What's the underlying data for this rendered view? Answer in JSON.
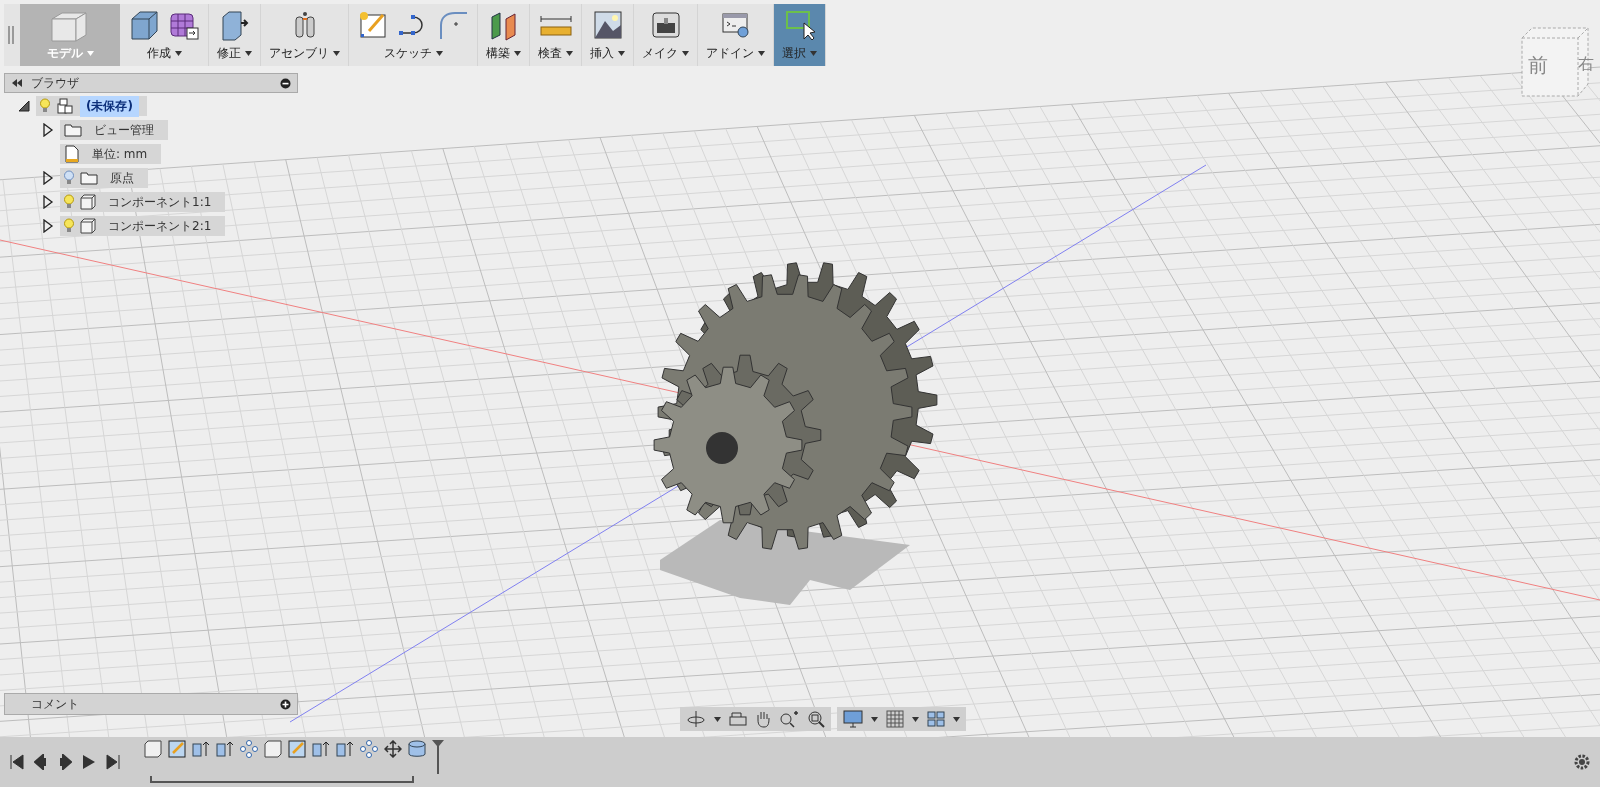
{
  "toolbar": {
    "workspace": {
      "label": "モデル",
      "selected": true
    },
    "groups": [
      {
        "label": "作成",
        "icons": [
          {
            "kind": "box"
          },
          {
            "kind": "mesh-cube"
          }
        ],
        "selected": false
      },
      {
        "label": "修正",
        "icons": [
          {
            "kind": "press-pull"
          }
        ],
        "selected": false
      },
      {
        "label": "アセンブリ",
        "icons": [
          {
            "kind": "joint"
          }
        ],
        "selected": false
      },
      {
        "label": "スケッチ",
        "icons": [
          {
            "kind": "sketch"
          },
          {
            "kind": "spline"
          },
          {
            "kind": "fillet"
          }
        ],
        "selected": false
      },
      {
        "label": "構築",
        "icons": [
          {
            "kind": "planes"
          }
        ],
        "selected": false
      },
      {
        "label": "検査",
        "icons": [
          {
            "kind": "ruler"
          }
        ],
        "selected": false
      },
      {
        "label": "挿入",
        "icons": [
          {
            "kind": "image"
          }
        ],
        "selected": false
      },
      {
        "label": "メイク",
        "icons": [
          {
            "kind": "printer"
          }
        ],
        "selected": false
      },
      {
        "label": "アドイン",
        "icons": [
          {
            "kind": "script"
          }
        ],
        "selected": false
      },
      {
        "label": "選択",
        "icons": [
          {
            "kind": "select"
          }
        ],
        "selected": true
      }
    ]
  },
  "browser": {
    "title": "ブラウザ",
    "tree": [
      {
        "label": "(未保存)",
        "kind": "root",
        "expanded": true,
        "selected": true,
        "visible": true,
        "children": [
          {
            "label": "ビュー管理",
            "kind": "folder",
            "expanded": false,
            "selected": false
          },
          {
            "label": "単位: mm",
            "kind": "units",
            "selected": false
          },
          {
            "label": "原点",
            "kind": "folder",
            "expanded": false,
            "selected": false,
            "visible": false
          },
          {
            "label": "コンポーネント1:1",
            "kind": "component",
            "expanded": false,
            "selected": false,
            "visible": true
          },
          {
            "label": "コンポーネント2:1",
            "kind": "component",
            "expanded": false,
            "selected": false,
            "visible": true
          }
        ]
      }
    ]
  },
  "viewcube": {
    "front": "前",
    "right": "右"
  },
  "comments": {
    "title": "コメント"
  },
  "timeline": {
    "steps": [
      {
        "kind": "box"
      },
      {
        "kind": "sketch"
      },
      {
        "kind": "extrude"
      },
      {
        "kind": "extrude"
      },
      {
        "kind": "pattern"
      },
      {
        "kind": "box"
      },
      {
        "kind": "sketch"
      },
      {
        "kind": "extrude"
      },
      {
        "kind": "extrude"
      },
      {
        "kind": "pattern"
      },
      {
        "kind": "move"
      },
      {
        "kind": "cylinder"
      }
    ]
  }
}
